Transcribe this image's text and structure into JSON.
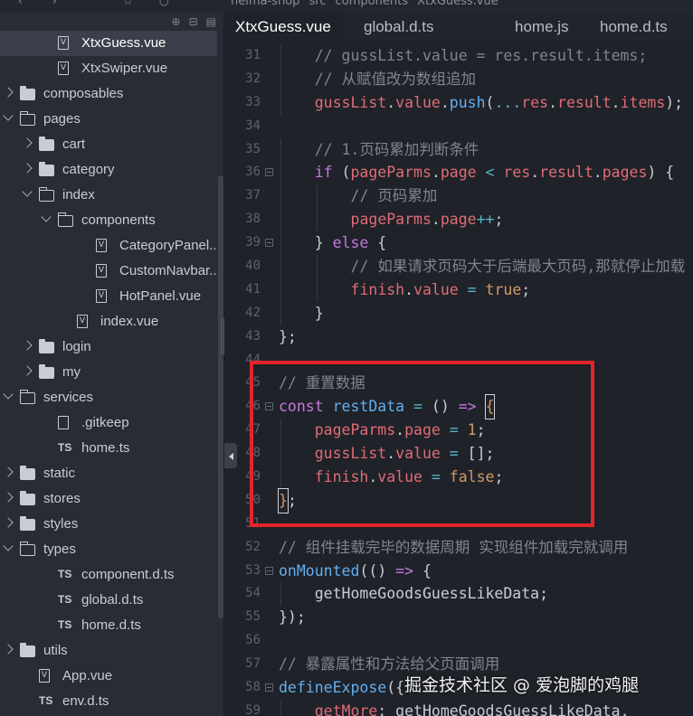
{
  "topbar": {
    "breadcrumbs": [
      "heima-shop",
      "src",
      "components",
      "XtxGuess.vue"
    ]
  },
  "sidebar": {
    "tree": [
      {
        "label": "XtxGuess.vue",
        "icon": "vue-file-icon",
        "depth": 2,
        "selected": true
      },
      {
        "label": "XtxSwiper.vue",
        "icon": "vue-file-icon",
        "depth": 2
      },
      {
        "label": "composables",
        "icon": "folder-icon",
        "depth": 0,
        "chevron": "right"
      },
      {
        "label": "pages",
        "icon": "folder-open-icon",
        "depth": 0,
        "chevron": "down"
      },
      {
        "label": "cart",
        "icon": "folder-icon",
        "depth": 1,
        "chevron": "right"
      },
      {
        "label": "category",
        "icon": "folder-icon",
        "depth": 1,
        "chevron": "right"
      },
      {
        "label": "index",
        "icon": "folder-open-icon",
        "depth": 1,
        "chevron": "down"
      },
      {
        "label": "components",
        "icon": "folder-open-icon",
        "depth": 2,
        "chevron": "down"
      },
      {
        "label": "CategoryPanel...",
        "icon": "vue-file-icon",
        "depth": 4
      },
      {
        "label": "CustomNavbar...",
        "icon": "vue-file-icon",
        "depth": 4
      },
      {
        "label": "HotPanel.vue",
        "icon": "vue-file-icon",
        "depth": 4
      },
      {
        "label": "index.vue",
        "icon": "vue-file-icon",
        "depth": 3
      },
      {
        "label": "login",
        "icon": "folder-icon",
        "depth": 1,
        "chevron": "right"
      },
      {
        "label": "my",
        "icon": "folder-icon",
        "depth": 1,
        "chevron": "right"
      },
      {
        "label": "services",
        "icon": "folder-open-icon",
        "depth": 0,
        "chevron": "down"
      },
      {
        "label": ".gitkeep",
        "icon": "file-icon",
        "depth": 2
      },
      {
        "label": "home.ts",
        "icon": "ts-file-icon",
        "depth": 2
      },
      {
        "label": "static",
        "icon": "folder-icon",
        "depth": 0,
        "chevron": "right"
      },
      {
        "label": "stores",
        "icon": "folder-icon",
        "depth": 0,
        "chevron": "right"
      },
      {
        "label": "styles",
        "icon": "folder-icon",
        "depth": 0,
        "chevron": "right"
      },
      {
        "label": "types",
        "icon": "folder-open-icon",
        "depth": 0,
        "chevron": "down"
      },
      {
        "label": "component.d.ts",
        "icon": "ts-file-icon",
        "depth": 2
      },
      {
        "label": "global.d.ts",
        "icon": "ts-file-icon",
        "depth": 2
      },
      {
        "label": "home.d.ts",
        "icon": "ts-file-icon",
        "depth": 2
      },
      {
        "label": "utils",
        "icon": "folder-icon",
        "depth": 0,
        "chevron": "right"
      },
      {
        "label": "App.vue",
        "icon": "vue-file-icon",
        "depth": 1
      },
      {
        "label": "env.d.ts",
        "icon": "ts-file-icon",
        "depth": 1
      }
    ]
  },
  "tabs": [
    {
      "label": "XtxGuess.vue",
      "active": true
    },
    {
      "label": "global.d.ts"
    },
    {
      "label": "home.js"
    },
    {
      "label": "home.d.ts"
    }
  ],
  "editor": {
    "lines": [
      {
        "n": "31",
        "indent": 1,
        "tokens": [
          [
            "// gussList.value = res.result.items;",
            "com"
          ]
        ]
      },
      {
        "n": "32",
        "indent": 1,
        "tokens": [
          [
            "// 从赋值改为数组追加",
            "com"
          ]
        ]
      },
      {
        "n": "33",
        "indent": 1,
        "tokens": [
          [
            "gussList",
            "var"
          ],
          [
            ".",
            "pl"
          ],
          [
            "value",
            "var"
          ],
          [
            ".",
            "pl"
          ],
          [
            "push",
            "fn"
          ],
          [
            "(",
            "pl"
          ],
          [
            "...",
            "op"
          ],
          [
            "res",
            "var"
          ],
          [
            ".",
            "pl"
          ],
          [
            "result",
            "var"
          ],
          [
            ".",
            "pl"
          ],
          [
            "items",
            "var"
          ],
          [
            ");",
            "pl"
          ]
        ]
      },
      {
        "n": "34",
        "indent": 0,
        "tokens": []
      },
      {
        "n": "35",
        "indent": 1,
        "tokens": [
          [
            "// 1.页码累加判断条件",
            "com"
          ]
        ]
      },
      {
        "n": "36",
        "indent": 1,
        "fold": true,
        "tokens": [
          [
            "if",
            "kw"
          ],
          [
            " (",
            "pl"
          ],
          [
            "pageParms",
            "var"
          ],
          [
            ".",
            "pl"
          ],
          [
            "page",
            "var"
          ],
          [
            " < ",
            "op"
          ],
          [
            "res",
            "var"
          ],
          [
            ".",
            "pl"
          ],
          [
            "result",
            "var"
          ],
          [
            ".",
            "pl"
          ],
          [
            "pages",
            "var"
          ],
          [
            ") {",
            "pl"
          ]
        ]
      },
      {
        "n": "37",
        "indent": 2,
        "tokens": [
          [
            "// 页码累加",
            "com"
          ]
        ]
      },
      {
        "n": "38",
        "indent": 2,
        "tokens": [
          [
            "pageParms",
            "var"
          ],
          [
            ".",
            "pl"
          ],
          [
            "page",
            "var"
          ],
          [
            "++",
            "op"
          ],
          [
            ";",
            "pl"
          ]
        ]
      },
      {
        "n": "39",
        "indent": 1,
        "fold": true,
        "tokens": [
          [
            "} ",
            "pl"
          ],
          [
            "else",
            "kw"
          ],
          [
            " {",
            "pl"
          ]
        ]
      },
      {
        "n": "40",
        "indent": 2,
        "tokens": [
          [
            "// 如果请求页码大于后端最大页码,那就停止加载",
            "com"
          ]
        ]
      },
      {
        "n": "41",
        "indent": 2,
        "tokens": [
          [
            "finish",
            "var"
          ],
          [
            ".",
            "pl"
          ],
          [
            "value",
            "var"
          ],
          [
            " = ",
            "op"
          ],
          [
            "true",
            "num"
          ],
          [
            ";",
            "pl"
          ]
        ]
      },
      {
        "n": "42",
        "indent": 1,
        "tokens": [
          [
            "}",
            "pl"
          ]
        ]
      },
      {
        "n": "43",
        "indent": 0,
        "tokens": [
          [
            "};",
            "pl"
          ]
        ]
      },
      {
        "n": "44",
        "indent": 0,
        "tokens": []
      },
      {
        "n": "45",
        "indent": 0,
        "tokens": [
          [
            "// 重置数据",
            "com"
          ]
        ]
      },
      {
        "n": "46",
        "indent": 0,
        "fold": true,
        "tokens": [
          [
            "const",
            "kw"
          ],
          [
            " ",
            "pl"
          ],
          [
            "restData",
            "fn"
          ],
          [
            " = ",
            "op"
          ],
          [
            "()",
            "pl"
          ],
          [
            " => ",
            "kw"
          ],
          [
            "{",
            "caret"
          ]
        ]
      },
      {
        "n": "47",
        "indent": 1,
        "tokens": [
          [
            "pageParms",
            "var"
          ],
          [
            ".",
            "pl"
          ],
          [
            "page",
            "var"
          ],
          [
            " = ",
            "op"
          ],
          [
            "1",
            "num"
          ],
          [
            ";",
            "pl"
          ]
        ]
      },
      {
        "n": "48",
        "indent": 1,
        "tokens": [
          [
            "gussList",
            "var"
          ],
          [
            ".",
            "pl"
          ],
          [
            "value",
            "var"
          ],
          [
            " = ",
            "op"
          ],
          [
            "[];",
            "pl"
          ]
        ]
      },
      {
        "n": "49",
        "indent": 1,
        "tokens": [
          [
            "finish",
            "var"
          ],
          [
            ".",
            "pl"
          ],
          [
            "value",
            "var"
          ],
          [
            " = ",
            "op"
          ],
          [
            "false",
            "num"
          ],
          [
            ";",
            "pl"
          ]
        ]
      },
      {
        "n": "50",
        "indent": 0,
        "tokens": [
          [
            "}",
            "caret"
          ],
          [
            ";",
            "pl"
          ]
        ]
      },
      {
        "n": "51",
        "indent": 0,
        "tokens": []
      },
      {
        "n": "52",
        "indent": 0,
        "tokens": [
          [
            "// 组件挂载完毕的数据周期 实现组件加载完就调用",
            "com"
          ]
        ]
      },
      {
        "n": "53",
        "indent": 0,
        "fold": true,
        "tokens": [
          [
            "onMounted",
            "fn"
          ],
          [
            "(() ",
            "pl"
          ],
          [
            "=>",
            "kw"
          ],
          [
            " {",
            "pl"
          ]
        ]
      },
      {
        "n": "54",
        "indent": 1,
        "tokens": [
          [
            "getHomeGoodsGuessLikeData",
            "pl"
          ],
          [
            ";",
            "pl"
          ]
        ]
      },
      {
        "n": "55",
        "indent": 0,
        "tokens": [
          [
            "});",
            "pl"
          ]
        ]
      },
      {
        "n": "56",
        "indent": 0,
        "tokens": []
      },
      {
        "n": "57",
        "indent": 0,
        "tokens": [
          [
            "// 暴露属性和方法给父页面调用",
            "com"
          ]
        ]
      },
      {
        "n": "58",
        "indent": 0,
        "fold": true,
        "tokens": [
          [
            "defineExpose",
            "fn"
          ],
          [
            "({",
            "pl"
          ]
        ]
      },
      {
        "n": "59",
        "indent": 1,
        "tokens": [
          [
            "getMore",
            "var"
          ],
          [
            ": ",
            "pl"
          ],
          [
            "getHomeGoodsGuessLikeData",
            "pl"
          ],
          [
            ",",
            "pl"
          ]
        ]
      }
    ]
  },
  "watermark": "掘金技术社区 @ 爱泡脚的鸡腿",
  "colors": {
    "highlight_box": "#e5242b",
    "keyword": "#c678dd",
    "variable": "#e06c75",
    "function": "#61afef",
    "number": "#d19a66",
    "comment": "#7f848e"
  }
}
